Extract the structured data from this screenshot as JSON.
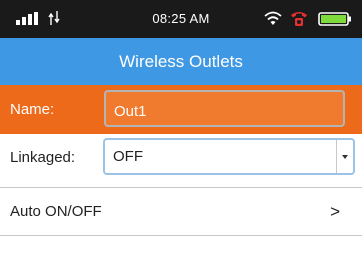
{
  "status_bar": {
    "time": "08:25 AM",
    "icons": [
      "signal-bars-icon",
      "data-transfer-icon",
      "wifi-icon",
      "phone-alarm-icon",
      "battery-icon"
    ],
    "battery_color": "#7fdb3c"
  },
  "header": {
    "title": "Wireless Outlets",
    "color": "#3f98e3"
  },
  "form": {
    "name_label": "Name:",
    "name_value": "Out1",
    "name_row_color": "#ee6a1b",
    "linkaged_label": "Linkaged:",
    "linkaged_value": "OFF",
    "auto_label": "Auto ON/OFF",
    "auto_chevron": ">"
  }
}
